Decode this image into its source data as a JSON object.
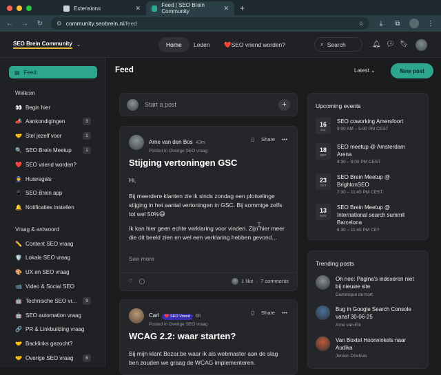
{
  "browser": {
    "tabs": [
      {
        "title": "Extensions",
        "active": false
      },
      {
        "title": "Feed | SEO Brein Community",
        "active": true
      }
    ],
    "url_host": "community.seobrein.nl",
    "url_path": "/feed"
  },
  "topnav": {
    "logo": "SEO Brein Community",
    "home": "Home",
    "members": "Leden",
    "friend": "❤️SEO vriend worden?",
    "search": "Search"
  },
  "sidebar": {
    "feed": "Feed",
    "sections": [
      {
        "title": "Welkom",
        "items": [
          {
            "icon": "👀",
            "label": "Begin hier",
            "badge": ""
          },
          {
            "icon": "📣",
            "label": "Aankondigingen",
            "badge": "3"
          },
          {
            "icon": "🤝",
            "label": "Stel jezelf voor",
            "badge": "1"
          },
          {
            "icon": "🔍",
            "label": "SEO Brein Meetup",
            "badge": "1"
          },
          {
            "icon": "❤️",
            "label": "SEO vriend worden?",
            "badge": ""
          },
          {
            "icon": "👮",
            "label": "Huisregels",
            "badge": ""
          },
          {
            "icon": "📱",
            "label": "SEO Brein app",
            "badge": ""
          },
          {
            "icon": "🔔",
            "label": "Notificaties instellen",
            "badge": ""
          }
        ]
      },
      {
        "title": "Vraag & antwoord",
        "items": [
          {
            "icon": "✏️",
            "label": "Content SEO vraag",
            "badge": ""
          },
          {
            "icon": "🛡️",
            "label": "Lokale SEO vraag",
            "badge": ""
          },
          {
            "icon": "🎨",
            "label": "UX en SEO vraag",
            "badge": ""
          },
          {
            "icon": "📹",
            "label": "Video & Social SEO",
            "badge": ""
          },
          {
            "icon": "🤖",
            "label": "Technische SEO vr...",
            "badge": "9"
          },
          {
            "icon": "🤖",
            "label": "SEO automation vraag",
            "badge": ""
          },
          {
            "icon": "🔗",
            "label": "PR & Linkbuilding vraag",
            "badge": ""
          },
          {
            "icon": "🤝",
            "label": "Backlinks gezocht?",
            "badge": ""
          },
          {
            "icon": "🤝",
            "label": "Overige SEO vraag",
            "badge": "6"
          }
        ]
      }
    ]
  },
  "main": {
    "title": "Feed",
    "sort": "Latest",
    "new_post": "New post",
    "composer_placeholder": "Start a post",
    "posts": [
      {
        "author": "Arne van den Bos",
        "time": "43m",
        "space": "Posted in Overige SEO vraag",
        "share": "Share",
        "title": "Stijging vertoningen GSC",
        "p1": "Hi,",
        "p2": "Bij meerdere klanten zie ik sinds zondag een plotselinge stijging in het aantal vertoningen in GSC. Bij sommige zelfs tot wel 50%😅",
        "p3": "Ik kan hier geen echte verklaring voor vinden. Zijn hier meer die dit beeld zien en wel een verklaring hebben gevond...",
        "see_more": "See more",
        "likes": "1 like",
        "comments": "7 comments"
      },
      {
        "author": "Carl",
        "badge": "❤️ SEO Vriend",
        "time": "6h",
        "space": "Posted in Overige SEO vraag",
        "share": "Share",
        "title": "WCAG 2.2: waar starten?",
        "p1": "Bij mijn klant Bozar.be waar ik als webmaster aan de slag ben zouden we graag de WCAG implementeren."
      }
    ]
  },
  "events": {
    "title": "Upcoming events",
    "items": [
      {
        "day": "16",
        "month": "JUL",
        "title": "SEO coworking Amersfoort",
        "time": "9:00 AM – 5:00 PM CEST"
      },
      {
        "day": "18",
        "month": "SEP",
        "title": "SEO meetup @ Amsterdam Arena",
        "time": "4:30 – 9:00 PM CEST"
      },
      {
        "day": "23",
        "month": "OCT",
        "title": "SEO Brein Meetup @ BrightonSEO",
        "time": "7:30 – 11:45 PM CEST"
      },
      {
        "day": "13",
        "month": "NOV",
        "title": "SEO Brein Meetup @ International search summit Barcelona",
        "time": "6:30 – 11:45 PM CET"
      }
    ]
  },
  "trending": {
    "title": "Trending posts",
    "items": [
      {
        "title": "Oh nee: Pagina's indexeren niet bij nieuwe site",
        "by": "Dominique de Kort"
      },
      {
        "title": "Bug in Google Search Console vanaf 30-06-25",
        "by": "Arne van Elk"
      },
      {
        "title": "Van Boxtel Hoorwinkels naar Audika",
        "by": "Jeroen Driehuis"
      }
    ]
  },
  "colors": {
    "accent": "#2ea58d",
    "background": "#1b1c1e",
    "card": "#252629"
  }
}
